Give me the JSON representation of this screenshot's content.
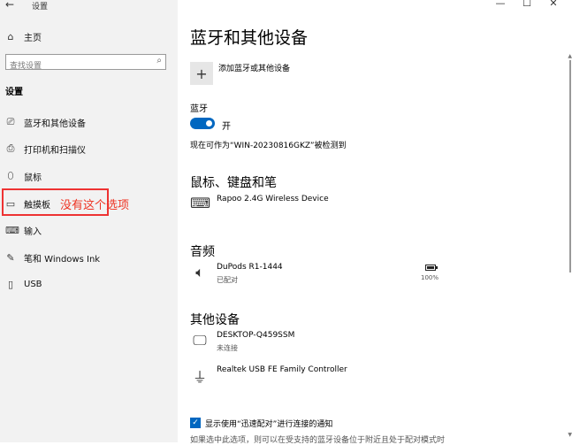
{
  "window": {
    "title": "设置",
    "min": "—",
    "max": "☐",
    "close": "✕",
    "back": "←"
  },
  "sidebar": {
    "home": "主页",
    "search_placeholder": "查找设置",
    "section": "设置",
    "items": [
      {
        "label": "蓝牙和其他设备",
        "icon": "bluetooth-devices-icon"
      },
      {
        "label": "打印机和扫描仪",
        "icon": "printer-icon"
      },
      {
        "label": "鼠标",
        "icon": "mouse-icon"
      },
      {
        "label": "触摸板",
        "icon": "touchpad-icon"
      },
      {
        "label": "输入",
        "icon": "keyboard-icon"
      },
      {
        "label": "笔和 Windows Ink",
        "icon": "pen-icon"
      },
      {
        "label": "USB",
        "icon": "usb-icon"
      }
    ]
  },
  "annotation": {
    "text": "没有这个选项",
    "color": "#e33333"
  },
  "main": {
    "title": "蓝牙和其他设备",
    "add_label": "添加蓝牙或其他设备",
    "bluetooth": {
      "heading": "蓝牙",
      "state": "开",
      "on": true,
      "discoverable": "现在可作为“WIN-20230816GKZ”被检测到"
    },
    "mouse_section": {
      "heading": "鼠标、键盘和笔",
      "devices": [
        {
          "name": "Rapoo 2.4G Wireless Device",
          "icon": "keyboard-icon"
        }
      ]
    },
    "audio_section": {
      "heading": "音频",
      "devices": [
        {
          "name": "DuPods R1-1444",
          "status": "已配对",
          "battery": "100%",
          "icon": "speaker-icon"
        }
      ]
    },
    "other_section": {
      "heading": "其他设备",
      "devices": [
        {
          "name": "DESKTOP-Q459SSM",
          "status": "未连接",
          "icon": "monitor-icon"
        },
        {
          "name": "Realtek USB FE Family Controller",
          "status": "",
          "icon": "usb-adapter-icon"
        }
      ]
    },
    "notify_checkbox": {
      "label": "显示使用“迅速配对”进行连接的通知",
      "checked": true
    },
    "footnote": "如果选中此选项，则可以在受支持的蓝牙设备位于附近且处于配对模式时"
  },
  "accent": "#0067c0"
}
